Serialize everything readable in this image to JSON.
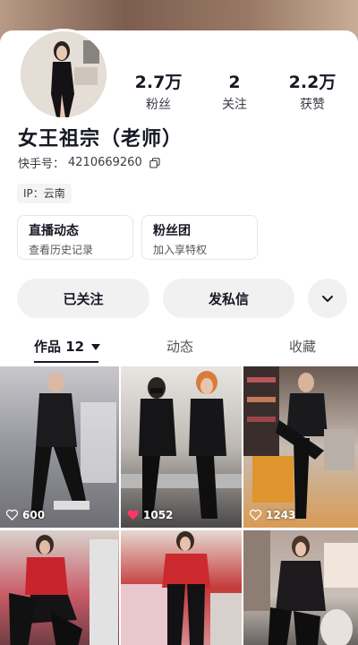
{
  "profile": {
    "name": "女王祖宗（老师）",
    "kuaishou_label": "快手号：",
    "kuaishou_id": "4210669260",
    "ip_tag": "IP：云南"
  },
  "stats": [
    {
      "value": "2.7万",
      "label": "粉丝"
    },
    {
      "value": "2",
      "label": "关注"
    },
    {
      "value": "2.2万",
      "label": "获赞"
    }
  ],
  "cards": [
    {
      "title": "直播动态",
      "subtitle": "查看历史记录"
    },
    {
      "title": "粉丝团",
      "subtitle": "加入享特权"
    }
  ],
  "buttons": {
    "followed": "已关注",
    "message": "发私信",
    "more_icon": "chevron-down-icon"
  },
  "tabs": [
    {
      "label": "作品 12",
      "active": true,
      "icon": "caret-down-icon"
    },
    {
      "label": "动态",
      "active": false
    },
    {
      "label": "收藏",
      "active": false
    }
  ],
  "videos": [
    {
      "likes": "600",
      "liked": false
    },
    {
      "likes": "1052",
      "liked": true
    },
    {
      "likes": "1243",
      "liked": false
    },
    {
      "likes": "",
      "liked": false
    },
    {
      "likes": "",
      "liked": false
    },
    {
      "likes": "",
      "liked": false
    }
  ],
  "colors": {
    "text_primary": "#161823",
    "liked_heart": "#fe3666",
    "button_bg": "#f1f1f2"
  }
}
